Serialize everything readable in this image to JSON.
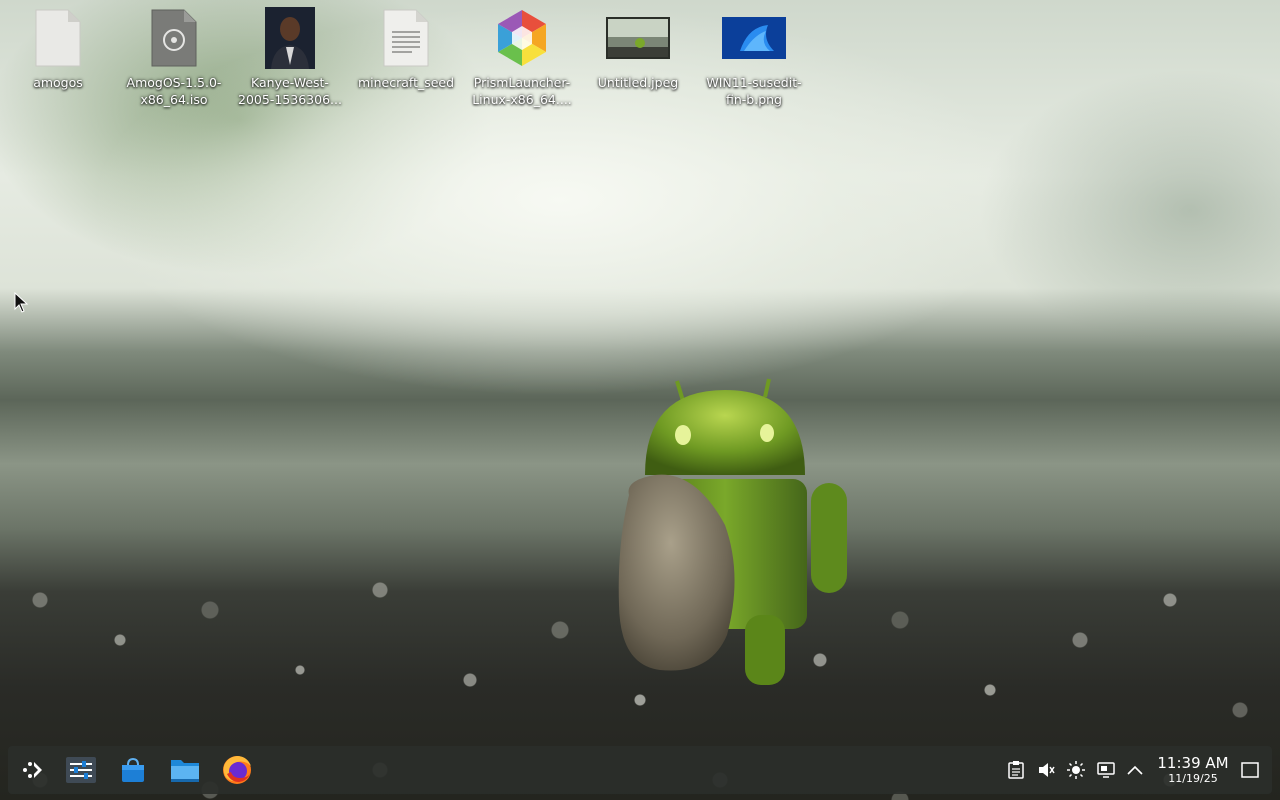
{
  "desktop": {
    "icons": [
      {
        "label": "amogos",
        "type": "generic-file-icon"
      },
      {
        "label": "AmogOS-1.5.0-x86_64.iso",
        "type": "disk-image-file-icon"
      },
      {
        "label": "Kanye-West-2005-1536306...",
        "type": "photo-thumbnail-icon"
      },
      {
        "label": "minecraft_seed",
        "type": "text-file-icon"
      },
      {
        "label": "PrismLauncher-Linux-x86_64....",
        "type": "prism-launcher-icon"
      },
      {
        "label": "Untitled.jpeg",
        "type": "image-thumbnail-icon"
      },
      {
        "label": "WIN11-susedit-fin-b.png",
        "type": "image-thumbnail-icon"
      }
    ]
  },
  "taskbar": {
    "launchers": [
      {
        "name": "application-menu",
        "icon": "app-launcher-icon"
      },
      {
        "name": "system-settings",
        "icon": "settings-sliders-icon"
      },
      {
        "name": "discover-store",
        "icon": "store-bag-icon"
      },
      {
        "name": "file-manager",
        "icon": "folder-icon"
      },
      {
        "name": "firefox",
        "icon": "firefox-icon"
      }
    ],
    "tray": {
      "icons": [
        "clipboard-icon",
        "volume-muted-icon",
        "brightness-icon",
        "display-icon",
        "expand-tray-icon"
      ],
      "clock": {
        "time": "11:39 AM",
        "date": "11/19/25"
      },
      "show_desktop": "show-desktop-icon"
    }
  },
  "colors": {
    "taskbar_bg": "#2a2e2a",
    "label_text": "#ffffff",
    "accent_blue": "#1d7fd6"
  }
}
